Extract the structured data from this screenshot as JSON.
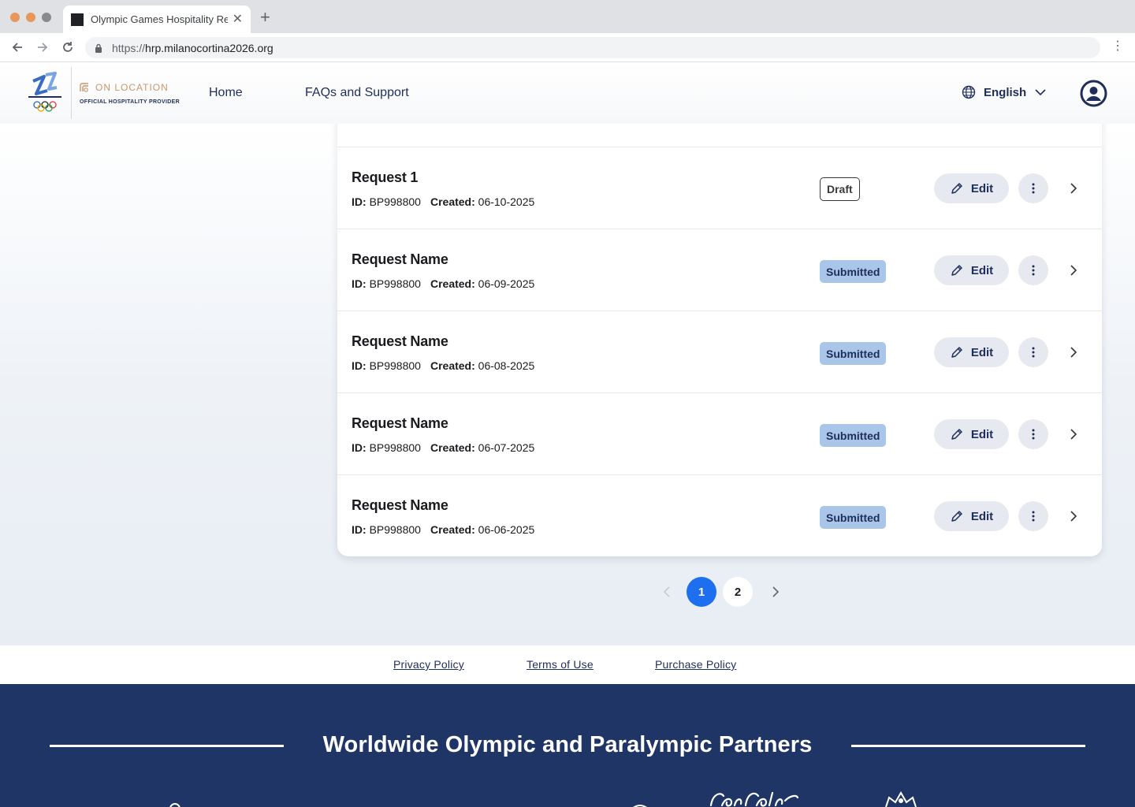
{
  "browser": {
    "tab_title": "Olympic Games Hospitality Rec",
    "url_scheme": "https://",
    "url_host": "hrp.milanocortina2026.org"
  },
  "header": {
    "brand_name": "ON LOCATION",
    "brand_sub": "OFFICIAL HOSPITALITY PROVIDER",
    "nav": [
      "Home",
      "FAQs and Support"
    ],
    "language": "English"
  },
  "requests": [
    {
      "name": "Request 1",
      "id_label": "ID:",
      "id": "BP998800",
      "created_label": "Created:",
      "created": "06-10-2025",
      "status": "Draft",
      "edit_label": "Edit"
    },
    {
      "name": "Request Name",
      "id_label": "ID:",
      "id": "BP998800",
      "created_label": "Created:",
      "created": "06-09-2025",
      "status": "Submitted",
      "edit_label": "Edit"
    },
    {
      "name": "Request Name",
      "id_label": "ID:",
      "id": "BP998800",
      "created_label": "Created:",
      "created": "06-08-2025",
      "status": "Submitted",
      "edit_label": "Edit"
    },
    {
      "name": "Request Name",
      "id_label": "ID:",
      "id": "BP998800",
      "created_label": "Created:",
      "created": "06-07-2025",
      "status": "Submitted",
      "edit_label": "Edit"
    },
    {
      "name": "Request Name",
      "id_label": "ID:",
      "id": "BP998800",
      "created_label": "Created:",
      "created": "06-06-2025",
      "status": "Submitted",
      "edit_label": "Edit"
    }
  ],
  "pagination": {
    "current": "1",
    "pages": [
      "1",
      "2"
    ]
  },
  "footer": {
    "links": [
      "Privacy Policy",
      "Terms of Use",
      "Purchase Policy"
    ]
  },
  "partners": {
    "title": "Worldwide Olympic and Paralympic Partners"
  },
  "colors": {
    "primary_navy": "#1f2d5a",
    "accent_blue": "#1e6ef0",
    "submitted_badge": "#a9c6e8",
    "partners_bg": "#1f3566",
    "brand_gold": "#c9976a"
  }
}
